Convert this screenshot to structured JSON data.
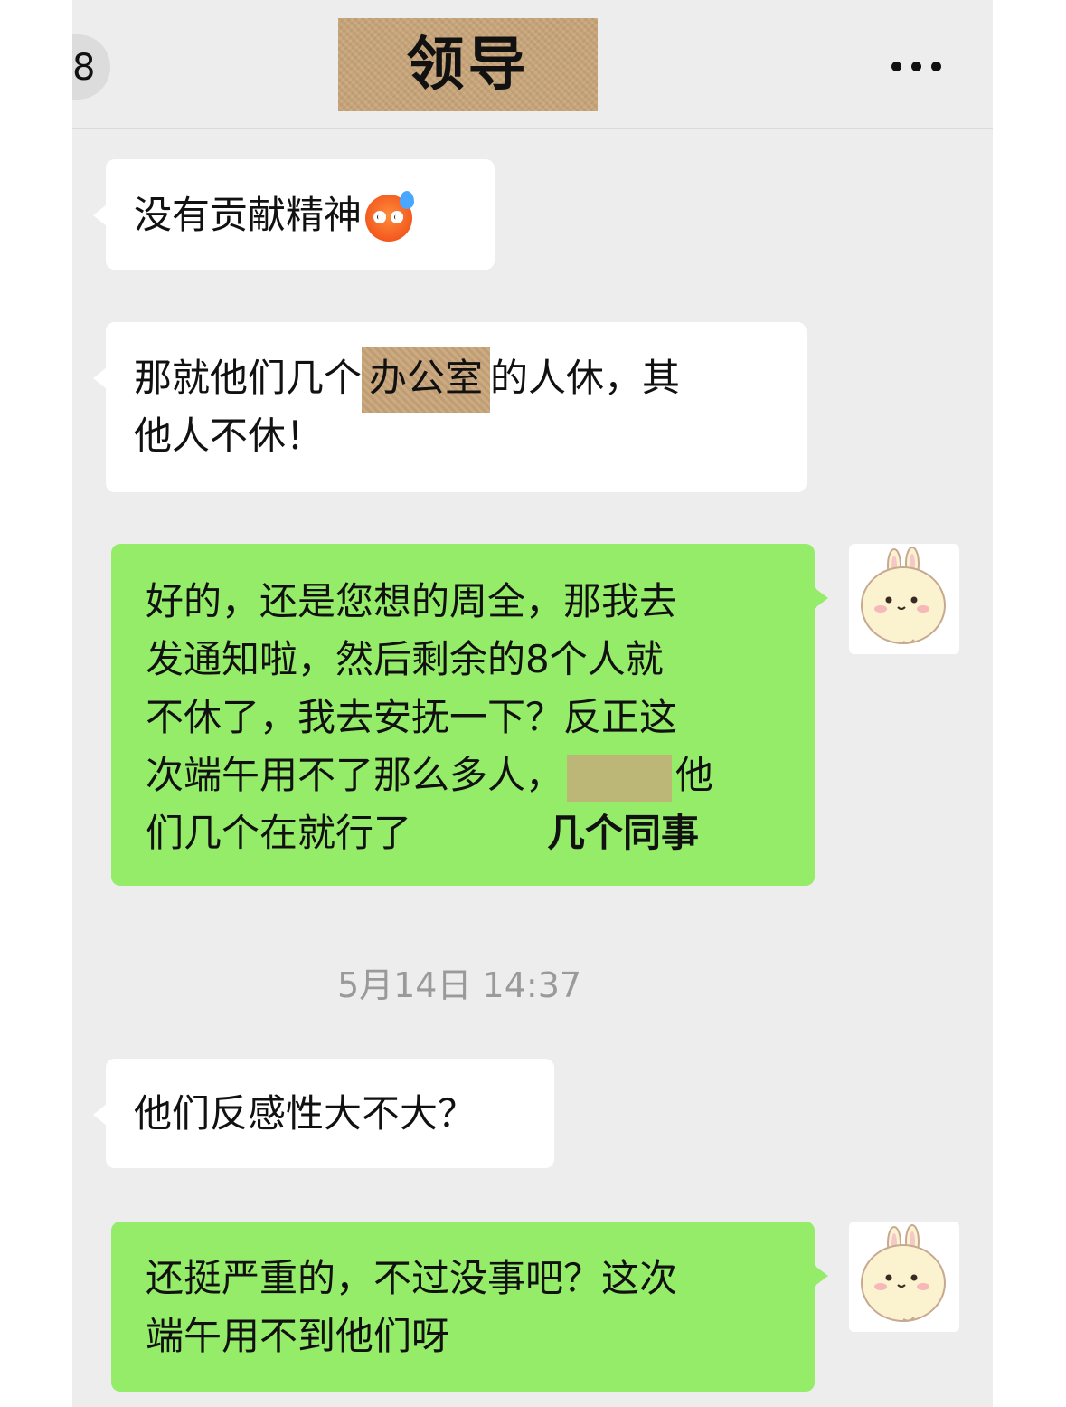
{
  "header": {
    "badge": "8",
    "title": "领导"
  },
  "messages": [
    {
      "side": "left",
      "lines": [
        "没有贡献精神"
      ],
      "emoji": "anxious-sweat-emoji"
    },
    {
      "side": "left",
      "line1_a": "那就他们几个",
      "line1_redact": "办公室",
      "line1_b": "的人休，其",
      "line2": "他人不休！"
    },
    {
      "side": "right",
      "lines": [
        "好的，还是您想的周全，那我去",
        "发通知啦，然后剩余的8个人就",
        "不休了，我去安抚一下？反正这"
      ],
      "line4_a": "次端午用不了那么多人，",
      "line4_b": "他",
      "line5": "们几个在就行了",
      "annotation": "几个同事"
    },
    {
      "side": "left",
      "lines": [
        "他们反感性大不大？"
      ]
    },
    {
      "side": "right",
      "lines": [
        "还挺严重的，不过没事吧？这次",
        "端午用不到他们呀"
      ]
    }
  ],
  "timestamp": "5月14日 14:37",
  "colors": {
    "background": "#ededed",
    "incoming_bubble": "#ffffff",
    "outgoing_bubble": "#95ec69",
    "redaction": "#c9a67b"
  },
  "icons": {
    "more": "more-dots-icon",
    "avatar": "bunny-avatar"
  }
}
